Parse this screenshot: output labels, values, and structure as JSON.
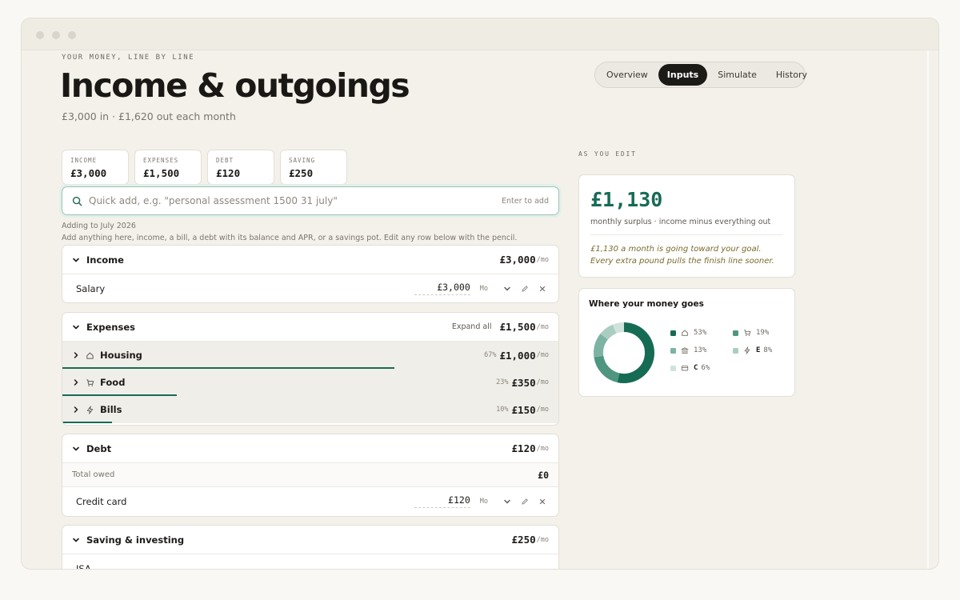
{
  "header": {
    "eyebrow": "YOUR MONEY, LINE BY LINE",
    "title": "Income & outgoings",
    "subtitle": "£3,000 in · £1,620 out each month"
  },
  "tabs": [
    {
      "label": "Overview",
      "active": false
    },
    {
      "label": "Inputs",
      "active": true
    },
    {
      "label": "Simulate",
      "active": false
    },
    {
      "label": "History",
      "active": false
    }
  ],
  "stats": [
    {
      "label": "INCOME",
      "value": "£3,000"
    },
    {
      "label": "EXPENSES",
      "value": "£1,500"
    },
    {
      "label": "DEBT",
      "value": "£120"
    },
    {
      "label": "SAVING",
      "value": "£250"
    }
  ],
  "quick_add": {
    "placeholder": "Quick add, e.g. \"personal assessment 1500 31 july\"",
    "hint": "Enter to add",
    "adding_to": "Adding to July 2026",
    "help": "Add anything here, income, a bill, a debt with its balance and APR, or a savings pot. Edit any row below with the pencil."
  },
  "per_suffix": "/mo",
  "income": {
    "title": "Income",
    "total": "£3,000",
    "rows": [
      {
        "label": "Salary",
        "value": "£3,000",
        "freq": "Mo"
      }
    ]
  },
  "expenses": {
    "title": "Expenses",
    "expand_all": "Expand all",
    "total": "£1,500",
    "categories": [
      {
        "label": "Housing",
        "icon": "home-icon",
        "pct": "67%",
        "amount": "£1,000",
        "share": 0.67
      },
      {
        "label": "Food",
        "icon": "cart-icon",
        "pct": "23%",
        "amount": "£350",
        "share": 0.23
      },
      {
        "label": "Bills",
        "icon": "bolt-icon",
        "pct": "10%",
        "amount": "£150",
        "share": 0.1
      }
    ]
  },
  "debt": {
    "title": "Debt",
    "total": "£120",
    "total_owed_label": "Total owed",
    "total_owed_value": "£0",
    "rows": [
      {
        "label": "Credit card",
        "value": "£120",
        "freq": "Mo"
      }
    ]
  },
  "saving": {
    "title": "Saving & investing",
    "total": "£250",
    "rows": [
      {
        "label": "ISA"
      }
    ]
  },
  "right": {
    "eyebrow": "AS YOU EDIT",
    "surplus_value": "£1,130",
    "surplus_caption": "monthly surplus · income minus everything out",
    "surplus_note": "£1,130 a month is going toward your goal. Every extra pound pulls the finish line sooner."
  },
  "breakdown": {
    "title": "Where your money goes",
    "items": [
      {
        "icon": "home-icon",
        "label": "53%",
        "value": 53,
        "color": "#166b54"
      },
      {
        "icon": "cart-icon",
        "label": "19%",
        "value": 19,
        "color": "#4f9680"
      },
      {
        "icon": "bank-icon",
        "label": "13%",
        "value": 13,
        "color": "#7db3a2"
      },
      {
        "icon": "bolt-icon",
        "tag": "E",
        "label": "8%",
        "value": 8,
        "color": "#a9cdc1"
      },
      {
        "icon": "card-icon",
        "tag": "C",
        "label": "6%",
        "value": 6,
        "color": "#cfe3dc"
      }
    ]
  }
}
